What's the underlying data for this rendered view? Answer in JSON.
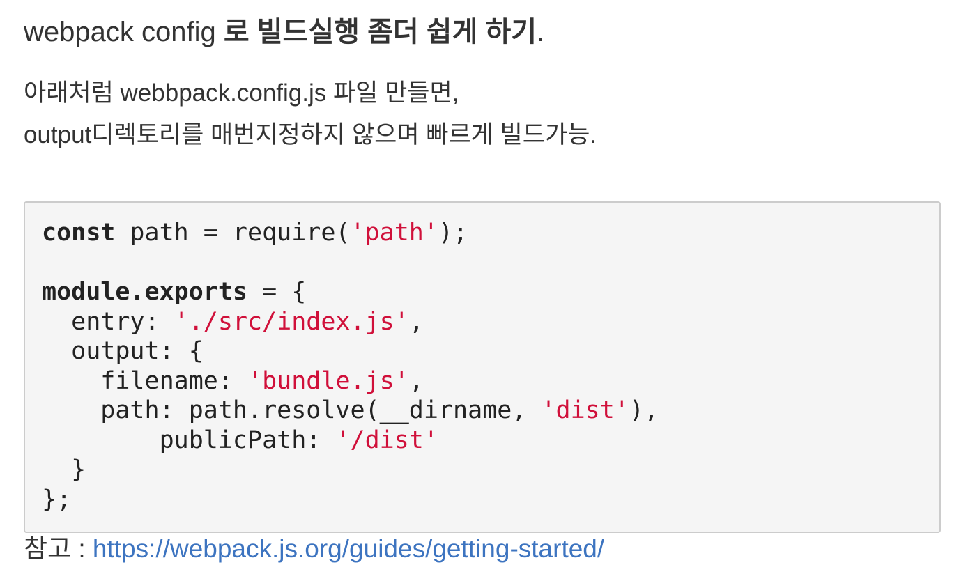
{
  "title": {
    "prefix": "webpack config ",
    "suffix": "로 빌드실행 좀더 쉽게 하기",
    "period": "."
  },
  "intro": {
    "line1": "아래처럼 webbpack.config.js 파일 만들면,",
    "line2": "output디렉토리를 매번지정하지 않으며 빠르게 빌드가능."
  },
  "code": {
    "l1_kw": "const",
    "l1_a": " path = require(",
    "l1_s": "'path'",
    "l1_b": ");",
    "l3_kw": "module.exports",
    "l3_a": " = {",
    "l4_a": "  entry: ",
    "l4_s": "'./src/index.js'",
    "l4_b": ",",
    "l5_a": "  output: {",
    "l6_a": "    filename: ",
    "l6_s": "'bundle.js'",
    "l6_b": ",",
    "l7_a": "    path: path.resolve(__dirname, ",
    "l7_s": "'dist'",
    "l7_b": "),",
    "l8_a": "        publicPath: ",
    "l8_s": "'/dist'",
    "l9_a": "  }",
    "l10_a": "};"
  },
  "reference": {
    "label": "참고 : ",
    "url": "https://webpack.js.org/guides/getting-started/"
  },
  "colors": {
    "string": "#d0103a",
    "link": "#3d74c0",
    "code_background": "#f5f5f5"
  }
}
